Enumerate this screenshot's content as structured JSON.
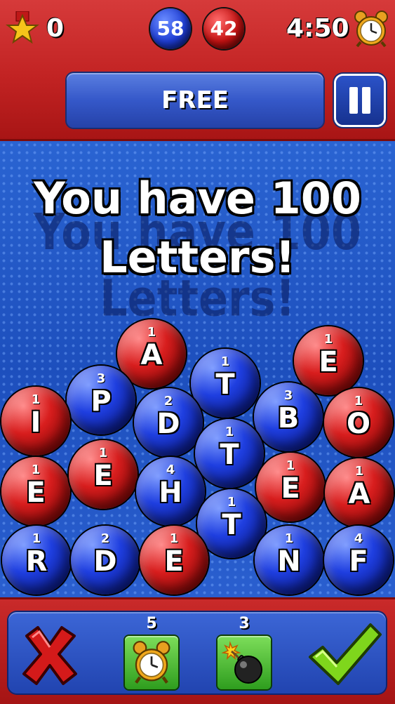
{
  "header": {
    "score": "0",
    "blue_count": "58",
    "red_count": "42",
    "timer": "4:50",
    "mode_label": "FREE"
  },
  "message": {
    "line1": "You have 100",
    "line2": "Letters!"
  },
  "tiles": [
    {
      "letter": "A",
      "points": "1",
      "color": "red"
    },
    {
      "letter": "E",
      "points": "1",
      "color": "red"
    },
    {
      "letter": "P",
      "points": "3",
      "color": "blue"
    },
    {
      "letter": "T",
      "points": "1",
      "color": "blue"
    },
    {
      "letter": "I",
      "points": "1",
      "color": "red"
    },
    {
      "letter": "D",
      "points": "2",
      "color": "blue"
    },
    {
      "letter": "B",
      "points": "3",
      "color": "blue"
    },
    {
      "letter": "O",
      "points": "1",
      "color": "red"
    },
    {
      "letter": "T",
      "points": "1",
      "color": "blue"
    },
    {
      "letter": "E",
      "points": "1",
      "color": "red"
    },
    {
      "letter": "E",
      "points": "1",
      "color": "red"
    },
    {
      "letter": "H",
      "points": "4",
      "color": "blue"
    },
    {
      "letter": "E",
      "points": "1",
      "color": "red"
    },
    {
      "letter": "A",
      "points": "1",
      "color": "red"
    },
    {
      "letter": "T",
      "points": "1",
      "color": "blue"
    },
    {
      "letter": "R",
      "points": "1",
      "color": "blue"
    },
    {
      "letter": "D",
      "points": "2",
      "color": "blue"
    },
    {
      "letter": "E",
      "points": "1",
      "color": "red"
    },
    {
      "letter": "N",
      "points": "1",
      "color": "blue"
    },
    {
      "letter": "F",
      "points": "4",
      "color": "blue"
    }
  ],
  "footer": {
    "clock_powerup_count": "5",
    "bomb_powerup_count": "3"
  },
  "colors": {
    "red": "#c41f1f",
    "blue": "#1f3fe0",
    "green": "#4cbb2e",
    "gold": "#f4c21b"
  },
  "icons": {
    "score": "star-medal-icon",
    "timer": "alarm-clock-icon",
    "pause": "pause-icon",
    "cancel": "red-x-icon",
    "submit": "green-check-icon",
    "powerup_1": "alarm-clock-icon",
    "powerup_2": "bomb-icon"
  }
}
